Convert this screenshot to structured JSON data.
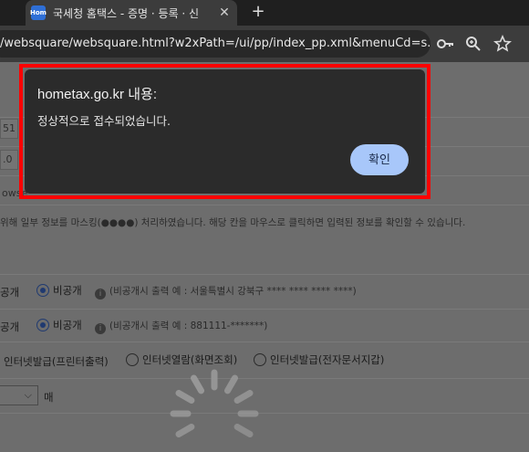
{
  "browser": {
    "tab_title": "국세청 홈택스 - 증명 · 등록 · 신",
    "tab_favicon_text": "Hom",
    "close_symbol": "✕",
    "new_tab_symbol": "+",
    "address": "/websquare/websquare.html?w2xPath=/ui/pp/index_pp.xml&menuCd=s...",
    "icons": [
      "key-icon",
      "zoom-icon",
      "bookmark-star-icon"
    ]
  },
  "page": {
    "field_fragments": [
      "51",
      ".0",
      "owse"
    ],
    "notice": "위해 일부 정보를 마스킹(●●●●) 처리하였습니다. 해당 칸을 마우스로 클릭하면 입력된 정보를 확인할 수 있습니다.",
    "address_row": {
      "public_label": "공개",
      "private_label": "비공개",
      "hint": "(비공개시 출력 예 : 서울특별시 강북구 **** **** **** ****)"
    },
    "id_row": {
      "public_label": "공개",
      "private_label": "비공개",
      "hint": "(비공개시 출력 예 : 881111-*******)"
    },
    "issue_options": [
      "인터넷발급(프린터출력)",
      "인터넷열람(화면조회)",
      "인터넷발급(전자문서지갑)"
    ],
    "copies_unit": "매",
    "select_arrow": "⌵"
  },
  "dialog": {
    "title": "hometax.go.kr 내용:",
    "message": "정상적으로 접수되었습니다.",
    "ok_label": "확인"
  },
  "colors": {
    "highlight": "#ff0000",
    "ok_button": "#a8c7fa",
    "dialog_bg": "#2b2b2b"
  }
}
